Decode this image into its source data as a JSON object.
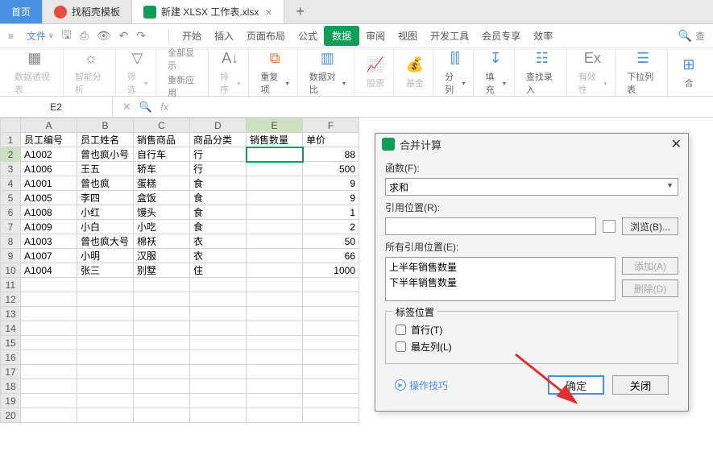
{
  "tabs": {
    "home": "首页",
    "t1": "找稻壳模板",
    "t2": "新建 XLSX 工作表.xlsx"
  },
  "file_menu": "文件",
  "ribbon_tabs": [
    "开始",
    "插入",
    "页面布局",
    "公式",
    "数据",
    "审阅",
    "视图",
    "开发工具",
    "会员专享",
    "效率"
  ],
  "ribbon_tabs_active_index": 4,
  "search_hint": "查",
  "ribbon_groups": {
    "pivot": "数据透视表",
    "analysis": "智能分析",
    "filter": "筛选",
    "showall": "全部显示",
    "reapply": "重新应用",
    "sort": "排序",
    "dup": "重复项",
    "compare": "数据对比",
    "stock": "股票",
    "fund": "基金",
    "split": "分列",
    "fill": "填充",
    "findentry": "查找录入",
    "validity": "有效性",
    "dropdown": "下拉列表",
    "combine": "合"
  },
  "namebox": "E2",
  "columns": [
    "A",
    "B",
    "C",
    "D",
    "E",
    "F"
  ],
  "headers": [
    "员工编号",
    "员工姓名",
    "销售商品",
    "商品分类",
    "销售数量",
    "单价"
  ],
  "rows": [
    {
      "a": "A1002",
      "b": "曾也疯小号",
      "c": "自行车",
      "d": "行",
      "e": "",
      "f": 88
    },
    {
      "a": "A1006",
      "b": "王五",
      "c": "轿车",
      "d": "行",
      "e": "",
      "f": 500
    },
    {
      "a": "A1001",
      "b": "曾也疯",
      "c": "蛋糕",
      "d": "食",
      "e": "",
      "f": 9
    },
    {
      "a": "A1005",
      "b": "李四",
      "c": "盒饭",
      "d": "食",
      "e": "",
      "f": 9
    },
    {
      "a": "A1008",
      "b": "小红",
      "c": "馒头",
      "d": "食",
      "e": "",
      "f": 1
    },
    {
      "a": "A1009",
      "b": "小白",
      "c": "小吃",
      "d": "食",
      "e": "",
      "f": 2
    },
    {
      "a": "A1003",
      "b": "曾也疯大号",
      "c": "棉袄",
      "d": "衣",
      "e": "",
      "f": 50
    },
    {
      "a": "A1007",
      "b": "小明",
      "c": "汉服",
      "d": "衣",
      "e": "",
      "f": 66
    },
    {
      "a": "A1004",
      "b": "张三",
      "c": "别墅",
      "d": "住",
      "e": "",
      "f": 1000
    }
  ],
  "dialog": {
    "title": "合并计算",
    "function_label": "函数(F):",
    "function_value": "求和",
    "ref_label": "引用位置(R):",
    "ref_value": "",
    "browse": "浏览(B)...",
    "allref_label": "所有引用位置(E):",
    "reflist": [
      "上半年销售数量",
      "下半年销售数量"
    ],
    "add": "添加(A)",
    "delete": "删除(D)",
    "labelpos": "标签位置",
    "toprow": "首行(T)",
    "leftcol": "最左列(L)",
    "tips": "操作技巧",
    "ok": "确定",
    "close": "关闭"
  }
}
